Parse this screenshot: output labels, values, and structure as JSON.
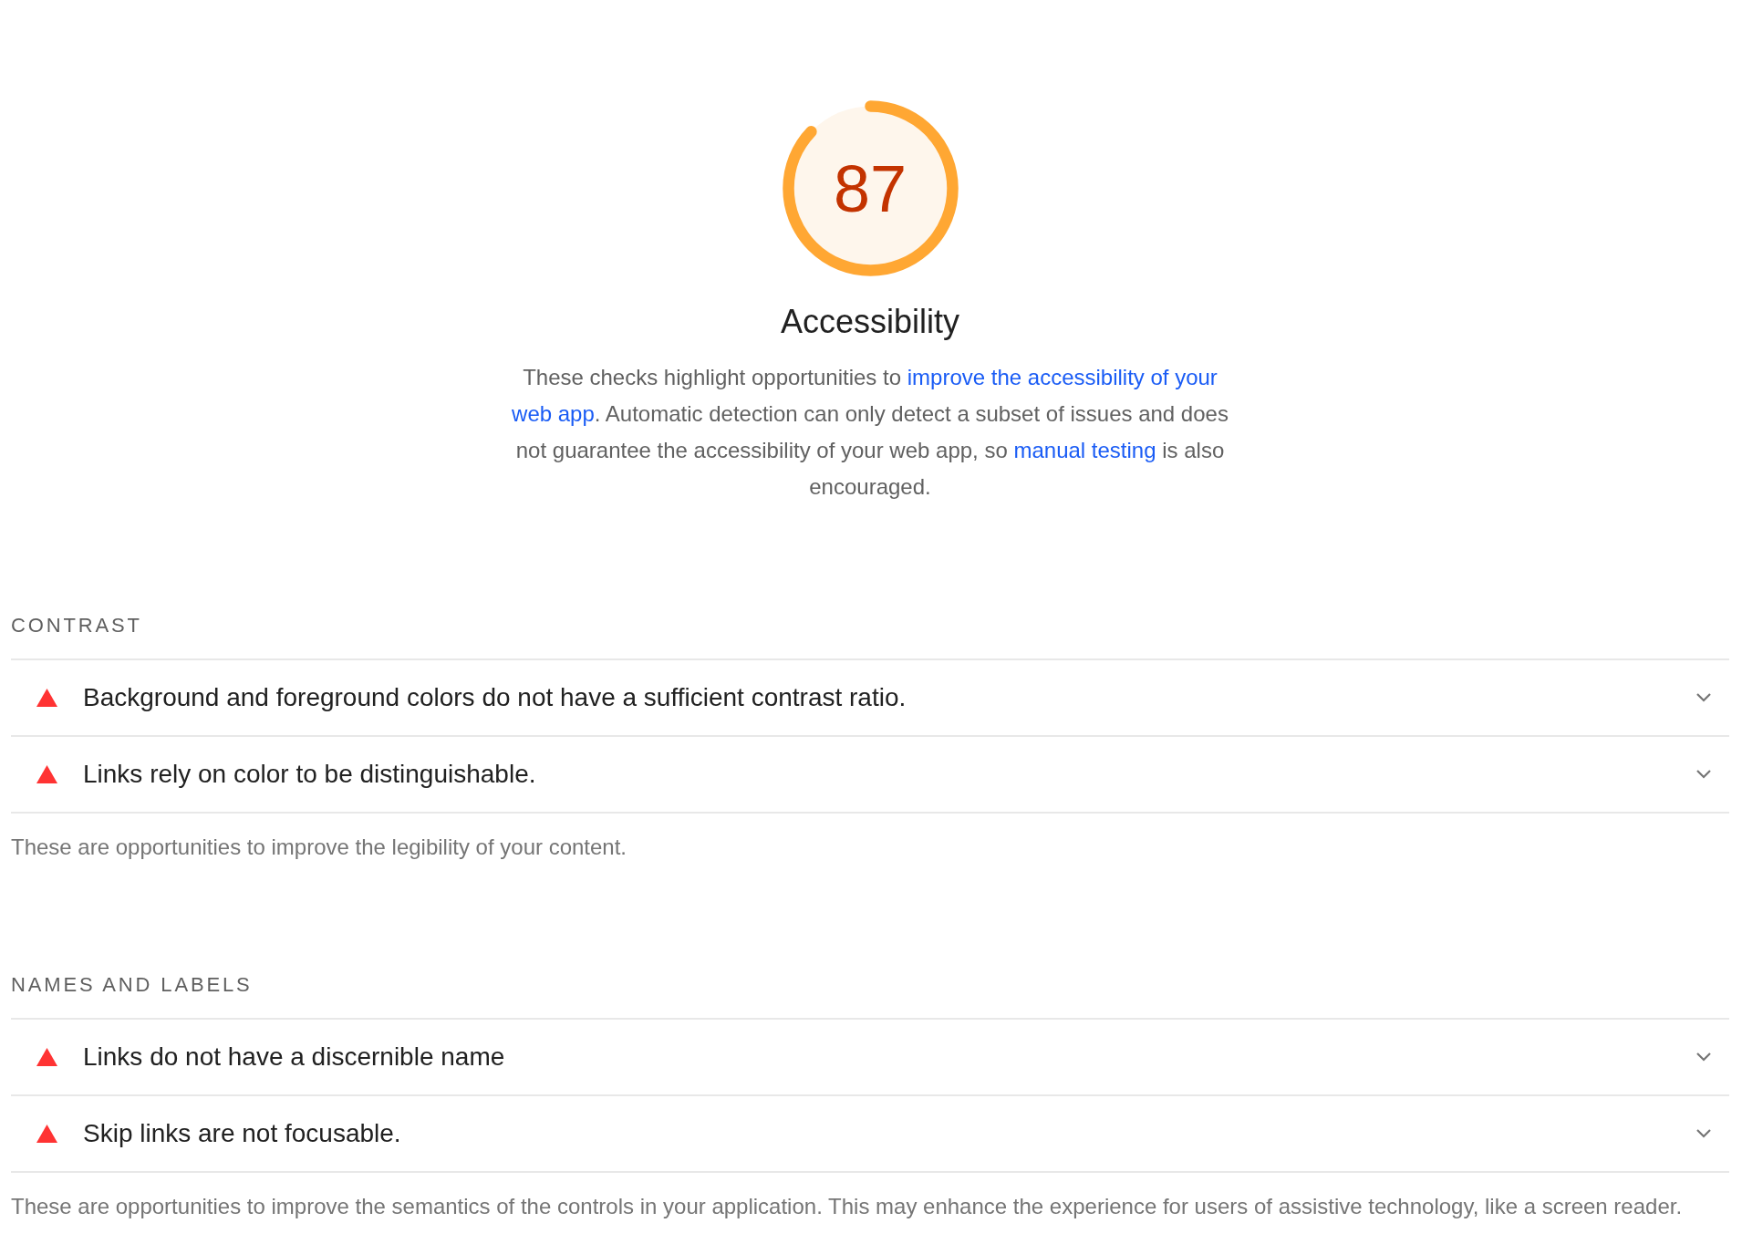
{
  "gauge": {
    "score": "87",
    "level": 0.87
  },
  "title": "Accessibility",
  "description": [
    {
      "kind": "text",
      "text": "These checks highlight opportunities to "
    },
    {
      "kind": "link",
      "text": "improve the accessibility of your"
    },
    {
      "kind": "link",
      "text": "web app"
    },
    {
      "kind": "text",
      "text": ". Automatic detection can only detect a subset of issues and does not guarantee the accessibility of your web app, so "
    },
    {
      "kind": "link",
      "text": "manual testing"
    },
    {
      "kind": "text",
      "text": " is also encouraged."
    }
  ],
  "groups": [
    {
      "heading": "CONTRAST",
      "audits": [
        {
          "title": "Background and foreground colors do not have a sufficient contrast ratio.",
          "expanded": false
        },
        {
          "title": "Links rely on color to be distinguishable.",
          "expanded": false
        }
      ],
      "description": "These are opportunities to improve the legibility of your content."
    },
    {
      "heading": "NAMES AND LABELS",
      "audits": [
        {
          "title": "Links do not have a discernible name",
          "expanded": false
        },
        {
          "title": "Skip links are not focusable.",
          "expanded": false
        }
      ],
      "description": "These are opportunities to improve the semantics of the controls in your application. This may enhance the experience for users of assistive technology, like a screen reader."
    }
  ]
}
